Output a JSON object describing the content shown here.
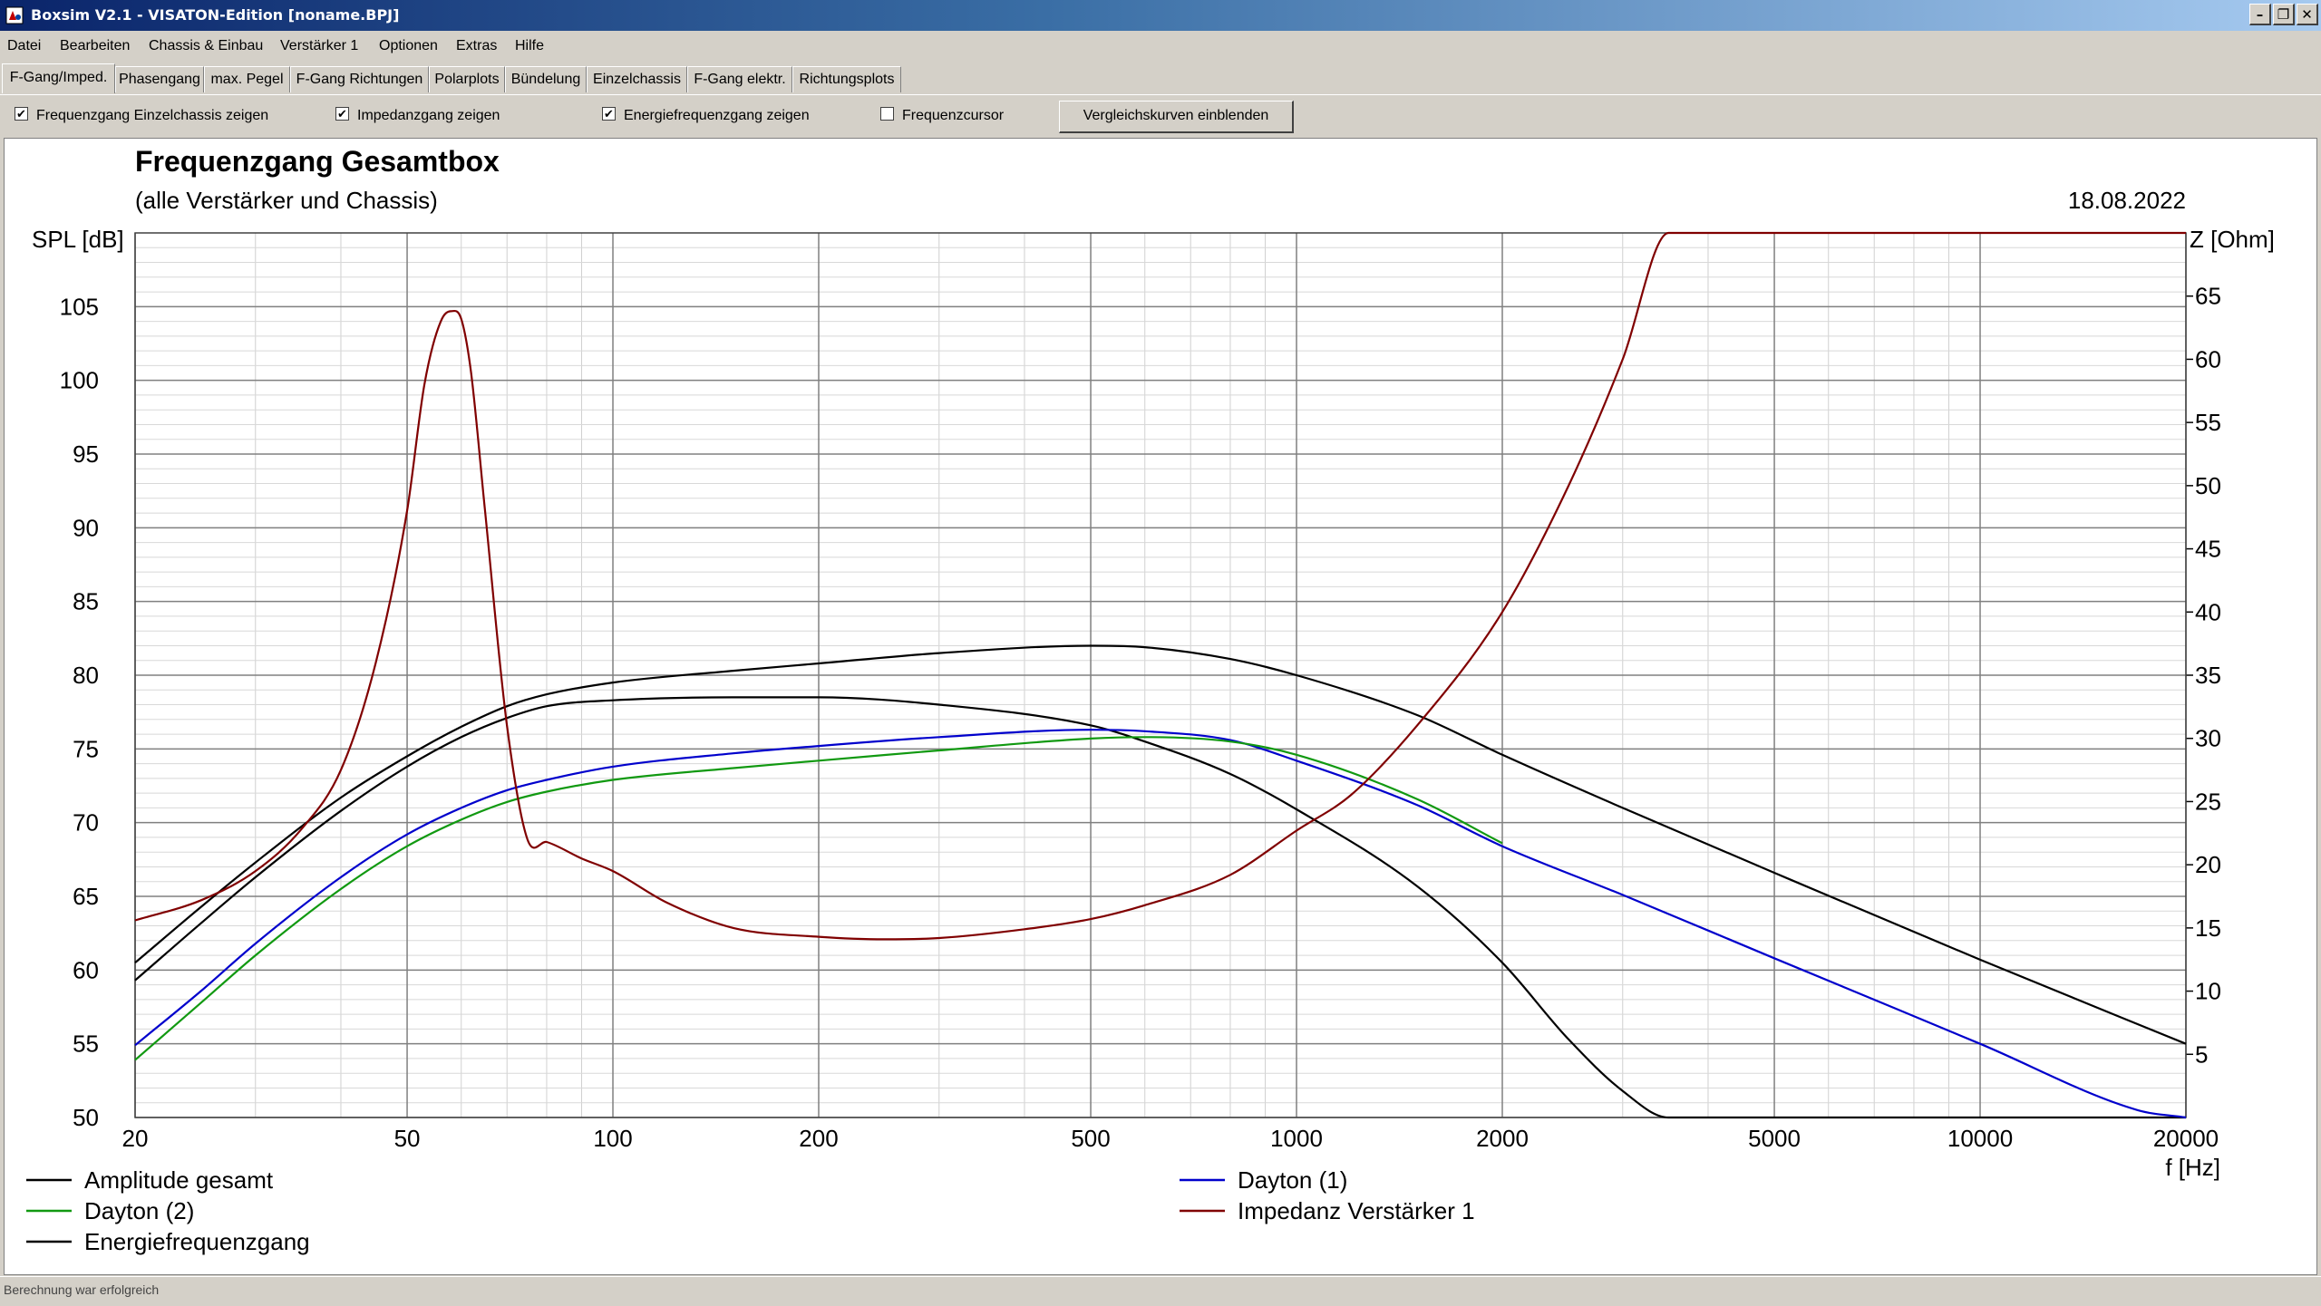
{
  "window": {
    "title": "Boxsim V2.1 - VISATON-Edition [noname.BPJ]",
    "minimize_glyph": "–",
    "restore_glyph": "❐",
    "close_glyph": "✕"
  },
  "menu": [
    "Datei",
    "Bearbeiten",
    "Chassis & Einbau",
    "Verstärker 1",
    "Optionen",
    "Extras",
    "Hilfe"
  ],
  "tabs": [
    {
      "label": "F-Gang/Imped.",
      "active": true
    },
    {
      "label": "Phasengang",
      "active": false
    },
    {
      "label": "max. Pegel",
      "active": false
    },
    {
      "label": "F-Gang Richtungen",
      "active": false
    },
    {
      "label": "Polarplots",
      "active": false
    },
    {
      "label": "Bündelung",
      "active": false
    },
    {
      "label": "Einzelchassis",
      "active": false
    },
    {
      "label": "F-Gang elektr.",
      "active": false
    },
    {
      "label": "Richtungsplots",
      "active": false
    }
  ],
  "options": {
    "checkboxes": [
      {
        "label": "Frequenzgang Einzelchassis zeigen",
        "checked": true
      },
      {
        "label": "Impedanzgang zeigen",
        "checked": true
      },
      {
        "label": "Energiefrequenzgang zeigen",
        "checked": true
      },
      {
        "label": "Frequenzcursor",
        "checked": false
      }
    ],
    "compare_button": "Vergleichskurven einblenden"
  },
  "status": "Berechnung war erfolgreich",
  "chart_data": {
    "type": "line",
    "title": "Frequenzgang Gesamtbox",
    "subtitle": "(alle Verstärker und Chassis)",
    "date": "18.08.2022",
    "xlabel": "f [Hz]",
    "ylabel": "SPL [dB]",
    "y2label": "Z [Ohm]",
    "xscale": "log",
    "xlim": [
      20,
      20000
    ],
    "ylim": [
      50,
      110
    ],
    "y2lim": [
      0,
      70
    ],
    "grid": true,
    "x_ticks": [
      20,
      50,
      100,
      200,
      500,
      1000,
      2000,
      5000,
      10000,
      20000
    ],
    "y_ticks": [
      50,
      55,
      60,
      65,
      70,
      75,
      80,
      85,
      90,
      95,
      100,
      105
    ],
    "y2_ticks": [
      5,
      10,
      15,
      20,
      25,
      30,
      35,
      40,
      45,
      50,
      55,
      60,
      65
    ],
    "legend_position": "bottom",
    "series": [
      {
        "name": "Amplitude gesamt",
        "axis": "left",
        "color": "#000000",
        "x": [
          20,
          25,
          30,
          40,
          50,
          60,
          70,
          80,
          100,
          150,
          200,
          300,
          500,
          600,
          800,
          1000,
          1500,
          2000,
          2500,
          3000,
          3500,
          4000,
          20000
        ],
        "y": [
          59.3,
          63.2,
          66.3,
          70.8,
          73.8,
          75.8,
          77.1,
          77.9,
          78.3,
          78.5,
          78.5,
          78.0,
          76.6,
          75.5,
          73.3,
          70.9,
          65.7,
          60.5,
          55.3,
          51.8,
          50.0,
          50.0,
          50.0
        ]
      },
      {
        "name": "Dayton  (1)",
        "axis": "left",
        "color": "#0000cc",
        "x": [
          20,
          25,
          30,
          40,
          50,
          60,
          70,
          80,
          100,
          150,
          200,
          300,
          500,
          600,
          800,
          1000,
          1500,
          2000,
          3000,
          5000,
          10000,
          17000,
          20000
        ],
        "y": [
          54.9,
          58.6,
          61.8,
          66.3,
          69.2,
          71.0,
          72.2,
          72.9,
          73.8,
          74.7,
          75.2,
          75.8,
          76.3,
          76.2,
          75.6,
          74.2,
          71.2,
          68.4,
          65.1,
          60.8,
          55.0,
          50.5,
          50.0
        ]
      },
      {
        "name": "Dayton (2)",
        "axis": "left",
        "color": "#119911",
        "x": [
          20,
          25,
          30,
          40,
          50,
          60,
          70,
          80,
          100,
          150,
          200,
          300,
          500,
          600,
          800,
          1000,
          1500,
          2000
        ],
        "y": [
          53.9,
          57.8,
          61.0,
          65.5,
          68.4,
          70.2,
          71.4,
          72.1,
          72.9,
          73.7,
          74.2,
          74.9,
          75.7,
          75.8,
          75.5,
          74.6,
          71.6,
          68.6
        ]
      },
      {
        "name": "Energiefrequenzgang",
        "axis": "left",
        "color": "#000000",
        "x": [
          20,
          25,
          30,
          40,
          50,
          60,
          70,
          80,
          100,
          150,
          200,
          300,
          500,
          600,
          800,
          1000,
          1500,
          2000,
          3000,
          5000,
          10000,
          20000
        ],
        "y": [
          60.5,
          64.3,
          67.3,
          71.7,
          74.5,
          76.5,
          77.9,
          78.7,
          79.5,
          80.3,
          80.8,
          81.5,
          82.0,
          81.9,
          81.1,
          80.0,
          77.3,
          74.6,
          71.0,
          66.6,
          60.7,
          55.0
        ]
      },
      {
        "name": "Impedanz Verstärker 1",
        "axis": "right",
        "color": "#800000",
        "x": [
          20,
          25,
          30,
          35,
          40,
          45,
          50,
          53,
          56,
          58,
          60,
          62,
          65,
          70,
          75,
          80,
          90,
          100,
          120,
          150,
          200,
          250,
          300,
          400,
          500,
          600,
          800,
          1000,
          1200,
          1500,
          2000,
          2500,
          3000,
          3500,
          20000
        ],
        "y": [
          15.6,
          17.2,
          19.5,
          22.8,
          27.5,
          36.0,
          48.0,
          58.0,
          63.0,
          63.8,
          63.2,
          59.0,
          48.0,
          31.0,
          22.0,
          21.8,
          20.5,
          19.5,
          17.0,
          15.0,
          14.3,
          14.1,
          14.2,
          14.9,
          15.7,
          16.8,
          19.2,
          22.7,
          25.5,
          31.0,
          40.0,
          50.0,
          60.0,
          70.0,
          70.0
        ]
      }
    ]
  }
}
